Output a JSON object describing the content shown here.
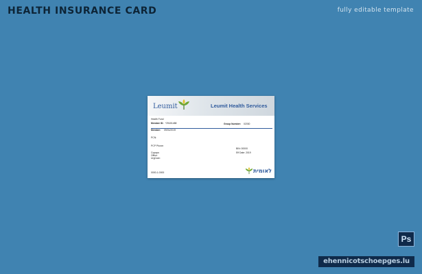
{
  "header": {
    "title": "HEALTH INSURANCE CARD",
    "subtitle": "fully editable template"
  },
  "card": {
    "logo_text": "Leumit",
    "header_title": "Leumit Health Services",
    "line_1": "Health Fund",
    "member_id_label": "Member ID:",
    "member_id_value": "*29401488",
    "group_number_label": "Group Number:",
    "group_number_value": "02030",
    "member_label": "Member:",
    "member_value": "09/01/2019",
    "pcn_label": "PCN:",
    "pcp_phone_label": "PCP Phone:",
    "copays_label": "Copays:",
    "office_label": "Office:",
    "urgcare_label": "UrgCare:",
    "right_line_1": "BIN: 00000",
    "right_line_2": "Eff Date: 2019",
    "bottom_left": "0000-1-0000",
    "footer_logo_text": "לאומית"
  },
  "badges": {
    "ps_label": "Ps",
    "website": "ehennicotschoepges.lu"
  },
  "colors": {
    "background": "#4083b1",
    "brand_blue": "#2f5a9c",
    "logo_green": "#6fa832",
    "logo_yellow": "#e3c12a",
    "badge_dark": "#0f2a4a"
  },
  "icons": {
    "logo_mark": "leaf-sprout-icon",
    "photoshop": "photoshop-icon"
  }
}
